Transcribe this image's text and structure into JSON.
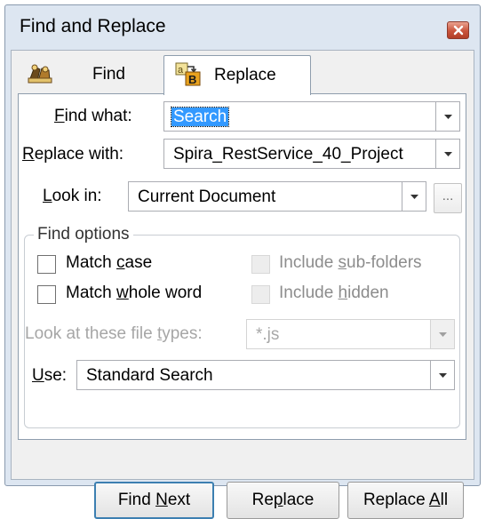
{
  "window": {
    "title": "Find and Replace"
  },
  "tabs": [
    {
      "label": "Find",
      "icon": "binoculars-icon",
      "active": false
    },
    {
      "label": "Replace",
      "icon": "replace-icon",
      "active": true
    }
  ],
  "find_what": {
    "label_pre": "",
    "label_key": "F",
    "label_post": "ind what:",
    "value": "Search"
  },
  "replace_with": {
    "label_key": "R",
    "label_post": "eplace with:",
    "value": "Spira_RestService_40_Project"
  },
  "look_in": {
    "label_key": "L",
    "label_post": "ook in:",
    "value": "Current Document",
    "browse_label": "..."
  },
  "find_options": {
    "title": "Find options",
    "match_case": {
      "pre": "Match ",
      "key": "c",
      "post": "ase",
      "checked": false
    },
    "match_whole_word": {
      "pre": "Match ",
      "key": "w",
      "post": "hole word",
      "checked": false
    },
    "include_sub_folders": {
      "pre": "Include ",
      "key": "s",
      "post": "ub-folders",
      "checked": false,
      "enabled": false
    },
    "include_hidden": {
      "pre": "Include ",
      "key": "h",
      "post": "idden",
      "checked": false,
      "enabled": false
    },
    "file_types": {
      "label_pre": "Look at these file ",
      "label_key": "t",
      "label_post": "ypes:",
      "value": "*.js",
      "enabled": false
    },
    "use": {
      "label_key": "U",
      "label_post": "se:",
      "value": "Standard Search"
    }
  },
  "buttons": {
    "find_next": {
      "pre": "Find ",
      "key": "N",
      "post": "ext"
    },
    "replace": {
      "pre": "Re",
      "key": "p",
      "post": "lace"
    },
    "replace_all": {
      "pre": "Replace ",
      "key": "A",
      "post": "ll"
    }
  },
  "colors": {
    "selection": "#3399ff",
    "close": "#c9543c",
    "default_button_border": "#3c7fb1"
  }
}
